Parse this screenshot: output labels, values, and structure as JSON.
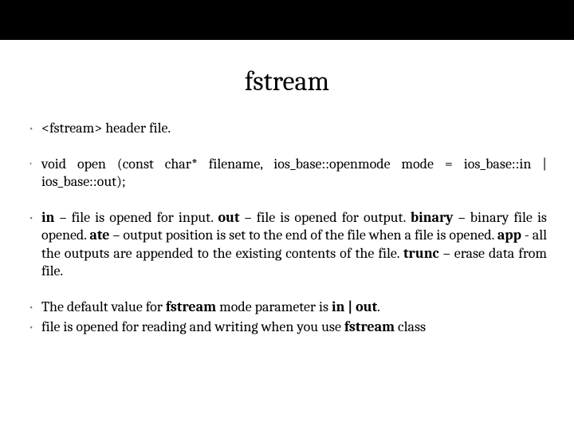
{
  "title": "fstream",
  "bullets": {
    "b1": "<fstream> header file.",
    "b2": "void open (const char* filename, ios_base::openmode mode = ios_base::in | ios_base::out);",
    "b3": {
      "in_kw": "in",
      "in_txt": " – file is opened for input. ",
      "out_kw": "out",
      "out_txt": " – file is opened for output. ",
      "binary_kw": "binary",
      "binary_txt": " – binary file is opened. ",
      "ate_kw": "ate",
      "ate_txt": " – output position is set to the end of the file when a file is opened. ",
      "app_kw": "app",
      "app_txt": " - all the outputs are appended to the existing contents of the file. ",
      "trunc_kw": "trunc",
      "trunc_txt": " – erase data from file."
    },
    "b4": {
      "pre": "The default value for ",
      "fstream": "fstream",
      "mid": " mode parameter is ",
      "inout": "in | out",
      "end": "."
    },
    "b5": {
      "pre": "file is opened for reading and writing when you use ",
      "fstream": "fstream",
      "post": " class"
    }
  }
}
